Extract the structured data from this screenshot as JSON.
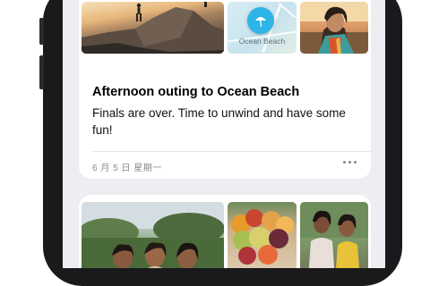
{
  "memory_card": {
    "map_label": "Ocean Beach",
    "title": "Afternoon outing to Ocean Beach",
    "description": "Finals are over. Time to unwind and have some fun!",
    "date": "6 月 5 日 星期一"
  },
  "icons": {
    "map_pin": "beach-umbrella-icon",
    "more": "ellipsis-icon"
  },
  "colors": {
    "screen_background": "#eeedf2",
    "card_background": "#ffffff",
    "map_pin": "#2fb4e8",
    "secondary_text": "#8a8a8e"
  }
}
